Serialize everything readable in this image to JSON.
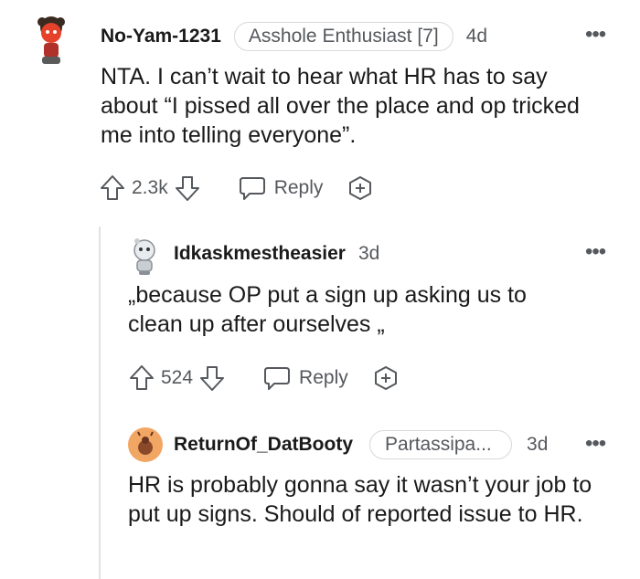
{
  "comments": [
    {
      "username": "No-Yam-1231",
      "flair": "Asshole Enthusiast [7]",
      "time": "4d",
      "body": "NTA. I can’t wait to hear what HR has to say about “I pissed all over the place and op tricked me into telling everyone”.",
      "votes": "2.3k",
      "reply_label": "Reply"
    },
    {
      "username": "Idkaskmestheasier",
      "time": "3d",
      "body": "„because OP put a sign up asking us to clean up after ourselves „",
      "votes": "524",
      "reply_label": "Reply"
    },
    {
      "username": "ReturnOf_DatBooty",
      "flair": "Partassipa...",
      "time": "3d",
      "body": "HR is probably gonna say it wasn’t your job to put up signs. Should of reported issue to HR."
    }
  ],
  "icons": {
    "upvote": "arrow-up-icon",
    "downvote": "arrow-down-icon",
    "reply": "speech-bubble-icon",
    "award": "award-plus-icon",
    "more": "more-dots-icon"
  },
  "colors": {
    "text": "#1a1a1b",
    "muted": "#55585c",
    "thread_line": "#dfe1e4",
    "avatar3": "#f2a663"
  }
}
